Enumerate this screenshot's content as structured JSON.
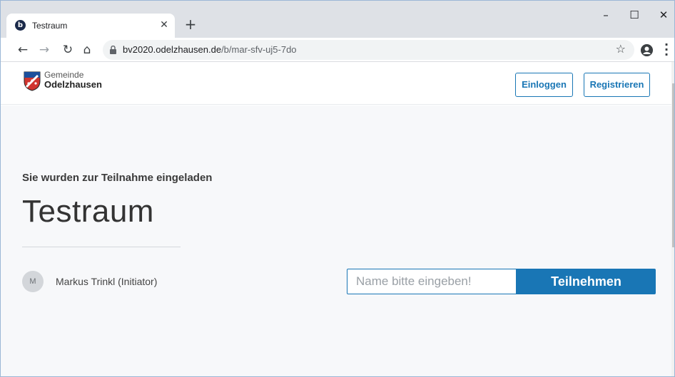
{
  "browser": {
    "tab_title": "Testraum",
    "tab_favicon_letter": "b",
    "url_host": "bv2020.odelzhausen.de",
    "url_path": "/b/mar-sfv-uj5-7do"
  },
  "header": {
    "logo_line1": "Gemeinde",
    "logo_line2": "Odelzhausen",
    "login_label": "Einloggen",
    "register_label": "Registrieren"
  },
  "main": {
    "invite_text": "Sie wurden zur Teilnahme eingeladen",
    "room_title": "Testraum",
    "avatar_initial": "M",
    "initiator": "Markus Trinkl (Initiator)",
    "name_placeholder": "Name bitte eingeben!",
    "join_label": "Teilnehmen"
  },
  "colors": {
    "accent": "#1976b5",
    "background": "#f7f8fa"
  },
  "icons": [
    "back-arrow-icon",
    "forward-arrow-icon",
    "reload-icon",
    "home-icon",
    "lock-icon",
    "star-icon",
    "profile-icon",
    "menu-icon",
    "close-icon",
    "new-tab-icon",
    "minimize-icon",
    "maximize-icon"
  ]
}
